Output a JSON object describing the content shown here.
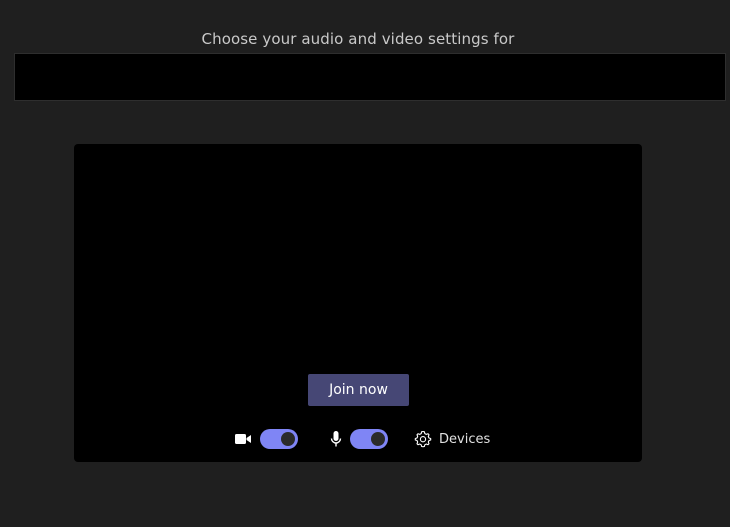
{
  "prejoin": {
    "heading": "Choose your audio and video settings for",
    "meeting_title": ""
  },
  "preview": {
    "join_button_label": "Join now"
  },
  "controls": {
    "camera_icon": "camera-icon",
    "camera_toggle_on": true,
    "mic_icon": "microphone-icon",
    "mic_toggle_on": true,
    "devices_icon": "gear-icon",
    "devices_label": "Devices"
  },
  "colors": {
    "background": "#1f1f1f",
    "preview_background": "#000000",
    "join_button": "#464775",
    "toggle_on": "#7f85f5"
  }
}
